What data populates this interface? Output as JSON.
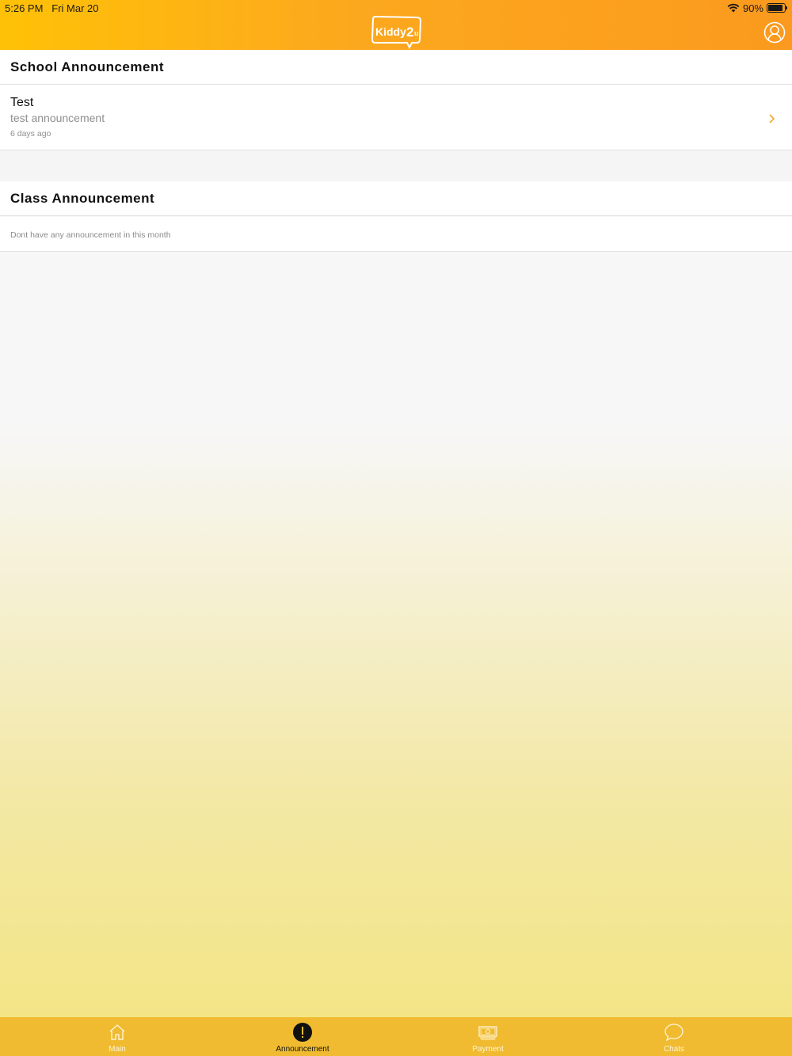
{
  "status_bar": {
    "time": "5:26 PM",
    "date": "Fri Mar 20",
    "battery": "90%",
    "battery_level": 0.9
  },
  "header": {
    "logo_text": "Kiddy2u",
    "profile_icon": "user-circle-icon"
  },
  "school_section": {
    "title": "School Announcement",
    "items": [
      {
        "title": "Test",
        "subtitle": "test announcement",
        "time": "6 days ago"
      }
    ]
  },
  "class_section": {
    "title": "Class Announcement",
    "empty_text": "Dont have any announcement in this month"
  },
  "tabs": [
    {
      "label": "Main",
      "icon": "home-icon",
      "active": false
    },
    {
      "label": "Announcement",
      "icon": "exclamation-icon",
      "active": true
    },
    {
      "label": "Payment",
      "icon": "money-icon",
      "active": false
    },
    {
      "label": "Chats",
      "icon": "chat-bubble-icon",
      "active": false
    }
  ],
  "colors": {
    "header_start": "#ffc107",
    "header_end": "#fb9a1e",
    "tabbar": "#f0bb30",
    "chevron": "#f0a830"
  }
}
